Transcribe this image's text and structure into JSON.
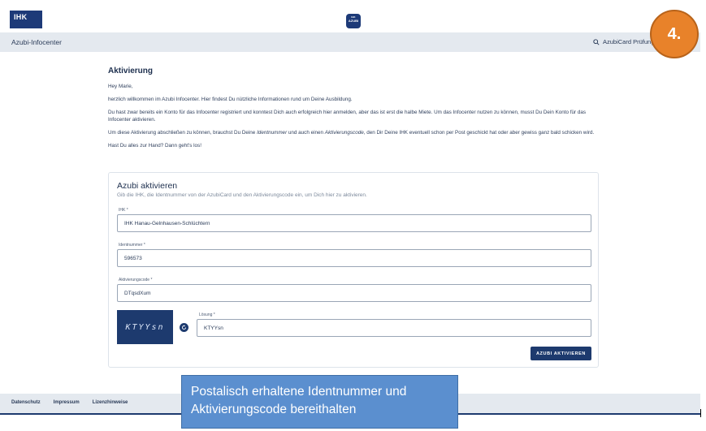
{
  "header": {
    "ihk_logo_text": "IHK",
    "azubi_logo_top": "IHK",
    "azubi_logo_text": "AZUBI"
  },
  "navbar": {
    "title": "Azubi-Infocenter",
    "search_label": "AzubiCard Prüfung"
  },
  "step_badge": "4.",
  "main": {
    "title": "Aktivierung",
    "greeting": "Hey Marie,",
    "welcome": "herzlich willkommen im Azubi Infocenter. Hier findest Du nützliche Informationen rund um Deine Ausbildung.",
    "info1": "Du hast zwar bereits ein Konto für das Infocenter registriert und konntest Dich auch erfolgreich hier anmelden, aber das ist erst die halbe Miete. Um das Infocenter nutzen zu können, musst Du Dein Konto für das Infocenter aktivieren.",
    "info2_a": "Um diese Aktivierung abschließen zu können, brauchst Du Deine ",
    "info2_em1": "Identnummer",
    "info2_b": " und auch einen ",
    "info2_em2": "Aktivierungscode",
    "info2_c": ", den Dir Deine IHK eventuell schon per Post geschickt hat oder aber gewiss ganz bald schicken wird.",
    "info3": "Hast Du alles zur Hand? Dann geht's los!"
  },
  "form": {
    "title": "Azubi aktivieren",
    "subtitle": "Gib die IHK, die Identnummer von der AzubiCard und den Aktivierungscode ein, um Dich hier zu aktivieren.",
    "ihk_label": "IHK *",
    "ihk_value": "IHK Hanau-Gelnhausen-Schlüchtern",
    "ident_label": "Identnummer *",
    "ident_value": "596573",
    "code_label": "Aktivierungscode *",
    "code_value": "DTqsdXum",
    "captcha_text": "KTYYsn",
    "solution_label": "Lösung *",
    "solution_value": "KTYYsn",
    "submit_label": "AZUBI AKTIVIEREN"
  },
  "footer": {
    "links": [
      "Datenschutz",
      "Impressum",
      "Lizenzhinweise"
    ]
  },
  "callout": {
    "line1": "Postalisch erhaltene Identnummer und",
    "line2": "Aktivierungscode bereithalten"
  },
  "colors": {
    "brand_navy": "#1d3a6e",
    "nav_bg": "#e4e9ef",
    "badge_orange": "#e8822a",
    "callout_blue": "#5b8fcf"
  }
}
